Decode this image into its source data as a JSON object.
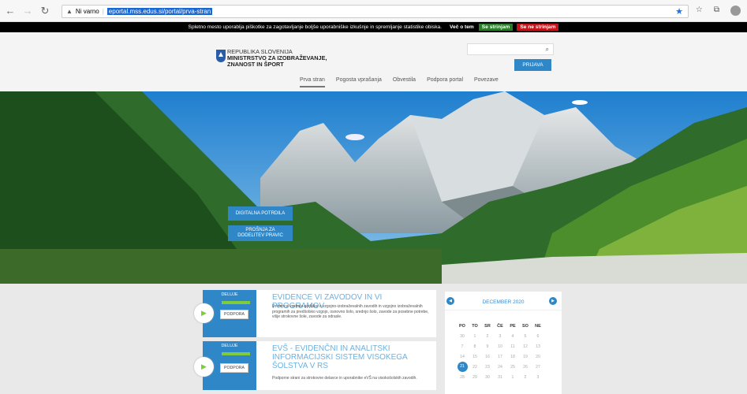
{
  "browser": {
    "warning": "Ni varno",
    "url": "eportal.mss.edus.si/portal/prva-stran"
  },
  "cookie": {
    "text": "Spletno mesto uporablja piškotke za zagotavljanje boljše uporabniške izkušnje in spremljanje statistike obiska.",
    "more": "Več o tem",
    "accept": "Se strinjam",
    "decline": "Se ne strinjam"
  },
  "header": {
    "org_line1": "REPUBLIKA SLOVENIJA",
    "org_line2": "MINISTRSTVO ZA IZOBRAŽEVANJE,",
    "org_line3": "ZNANOST IN ŠPORT",
    "login": "PRIJAVA"
  },
  "menu": [
    "Prva stran",
    "Pogosta vprašanja",
    "Obvestila",
    "Podpora portal",
    "Povezave"
  ],
  "hero": {
    "btn1": "DIGITALNA POTRDILA",
    "btn2": "PROŠNJA ZA\nDODELITEV PRAVIC"
  },
  "cards": [
    {
      "status": "DELUJE",
      "support": "PODPORA",
      "title": "EVIDENCE VI ZAVODOV IN VI PROGRAMOV",
      "desc": "Evidenca vsebuje podatke o vzgojno-izobraževalnih zavodih in vzgojno izobraževalnih programih za predšolsko vzgojo, osnovno šolo, srednjo šolo, zavode za posebne potrebe, višje strokovne šole, zavode za odrasle."
    },
    {
      "status": "DELUJE",
      "support": "PODPORA",
      "title": "EVŠ - EVIDENČNI IN ANALITSKI INFORMACIJSKI SISTEM VISOKEGA ŠOLSTVA V RS",
      "desc": "Podporne strani za strokovne delavce in uporabnike eVŠ na visokošolskih zavodih."
    }
  ],
  "calendar": {
    "month": "DECEMBER 2020",
    "days": [
      "PO",
      "TO",
      "SR",
      "ČE",
      "PE",
      "SO",
      "NE"
    ],
    "weeks": [
      [
        "30",
        "1",
        "2",
        "3",
        "4",
        "5",
        "6"
      ],
      [
        "7",
        "8",
        "9",
        "10",
        "11",
        "12",
        "13"
      ],
      [
        "14",
        "15",
        "16",
        "17",
        "18",
        "19",
        "20"
      ],
      [
        "21",
        "22",
        "23",
        "24",
        "25",
        "26",
        "27"
      ],
      [
        "28",
        "29",
        "30",
        "31",
        "1",
        "2",
        "3"
      ]
    ],
    "today": "21"
  }
}
